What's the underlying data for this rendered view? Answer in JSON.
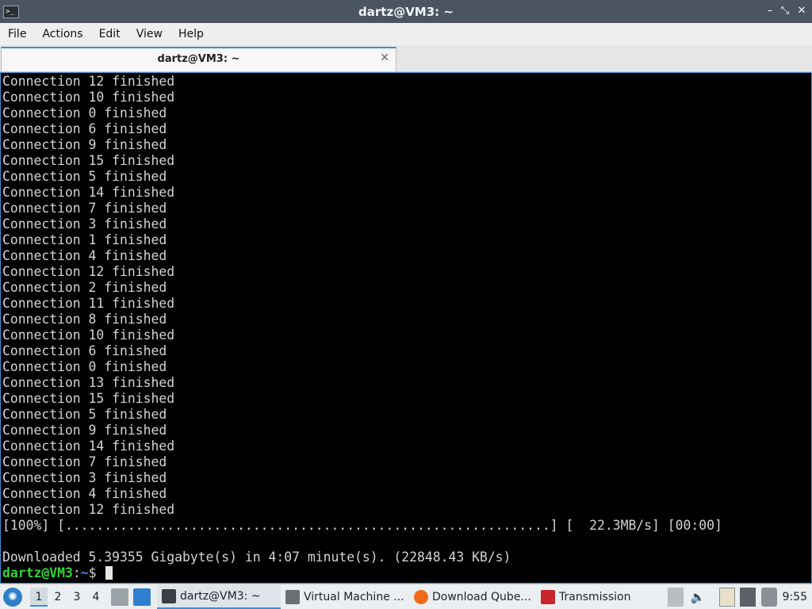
{
  "window": {
    "title": "dartz@VM3: ~"
  },
  "menu": {
    "items": [
      "File",
      "Actions",
      "Edit",
      "View",
      "Help"
    ]
  },
  "tabs": [
    {
      "label": "dartz@VM3: ~"
    }
  ],
  "terminal": {
    "lines": [
      "Connection 12 finished",
      "Connection 10 finished",
      "Connection 0 finished",
      "Connection 6 finished",
      "Connection 9 finished",
      "Connection 15 finished",
      "Connection 5 finished",
      "Connection 14 finished",
      "Connection 7 finished",
      "Connection 3 finished",
      "Connection 1 finished",
      "Connection 4 finished",
      "Connection 12 finished",
      "Connection 2 finished",
      "Connection 11 finished",
      "Connection 8 finished",
      "Connection 10 finished",
      "Connection 6 finished",
      "Connection 0 finished",
      "Connection 13 finished",
      "Connection 15 finished",
      "Connection 5 finished",
      "Connection 9 finished",
      "Connection 14 finished",
      "Connection 7 finished",
      "Connection 3 finished",
      "Connection 4 finished",
      "Connection 12 finished",
      "[100%] [..............................................................] [  22.3MB/s] [00:00]",
      "",
      "Downloaded 5.39355 Gigabyte(s) in 4:07 minute(s). (22848.43 KB/s)"
    ],
    "prompt": {
      "user_host": "dartz@VM3",
      "separator": ":",
      "path": "~",
      "symbol": "$ "
    }
  },
  "taskbar": {
    "workspaces": [
      "1",
      "2",
      "3",
      "4"
    ],
    "tasks": [
      {
        "label": "dartz@VM3: ~",
        "icon": "terminal-icon",
        "active": true
      },
      {
        "label": "Virtual Machine ...",
        "icon": "virtual-machine-icon",
        "active": false
      },
      {
        "label": "Download Qube...",
        "icon": "firefox-icon",
        "active": false
      },
      {
        "label": "Transmission",
        "icon": "transmission-icon",
        "active": false
      }
    ],
    "tray_icons": [
      "upload-icon",
      "volume-icon",
      "clipboard-icon",
      "network-icon",
      "notification-icon",
      "network-status-icon"
    ],
    "clock": "9:55"
  },
  "colors": {
    "titlebar": "#4a5561",
    "accent": "#3d8fd1",
    "prompt_user": "#33d43a",
    "prompt_path": "#3b8eea",
    "terminal_text": "#d3d3d3"
  }
}
